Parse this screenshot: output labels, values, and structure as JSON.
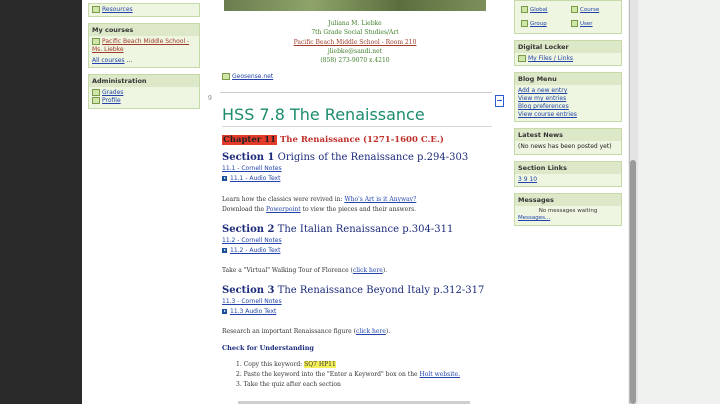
{
  "left": {
    "resources": "Resources",
    "my_courses_title": "My courses",
    "course_link": "Pacific Beach Middle School - Ms. Liebke",
    "all_courses": "All courses",
    "all_courses_suffix": " ...",
    "admin_title": "Administration",
    "admin_items": [
      "Grades",
      "Profile"
    ]
  },
  "contact": {
    "name": "Juliana M. Liebke",
    "role": "7th Grade Social Studies/Art",
    "school": "Pacific Beach Middle School - Room 210",
    "email": "jliebke@sandi.net",
    "phone": "(858) 273-9070 x.4210"
  },
  "geo_link": "Geosense.net",
  "section_number": "9",
  "main": {
    "title": "HSS 7.8 The Renaissance",
    "chapter_tag": "Chapter 11",
    "chapter_title": " The Renaissance (1271-1600 C.E.)",
    "s1_label": "Section 1",
    "s1_title": " Origins of the Renaissance p.294-303",
    "s1_notes": "11.1 - Cornell Notes",
    "s1_audio": "11.1 - Audio Text",
    "s1_text_pre": "Learn how the classics were revived in: ",
    "s1_text_link": "Who's Art is it Anyway?",
    "s1_text2_pre": "Download the ",
    "s1_text2_link": "Powerpoint",
    "s1_text2_post": " to view the pieces and their answers.",
    "s2_label": "Section 2",
    "s2_title": " The Italian Renaissance p.304-311",
    "s2_notes": "11.2 - Cornell Notes",
    "s2_audio": "11.2 - Audio Text",
    "s2_text_pre": "Take a \"Virtual\" Walking Tour of Florence (",
    "s2_text_link": "click here",
    "s2_text_post": ").",
    "s3_label": "Section 3",
    "s3_title": " The Renaissance Beyond Italy p.312-317",
    "s3_notes": "11.3 - Cornell Notes",
    "s3_audio": "11.3 Audio Text",
    "s3_text_pre": "Research an important Renaissance figure (",
    "s3_text_link": "click here",
    "s3_text_post": ").",
    "cfu": "Check for Understanding",
    "step1_pre": "1.   Copy this keyword: ",
    "step1_key": "SQ7 HP11",
    "step2_pre": "2.   Paste the keyword into the \"Enter a Keyword\" box on the ",
    "step2_link": "Holt website.",
    "step3": "3.   Take the quiz after each section"
  },
  "right": {
    "icons": [
      "Global",
      "Course",
      "Group",
      "User"
    ],
    "digital_locker_title": "Digital Locker",
    "my_files": "My Files / Links",
    "blog_menu_title": "Blog Menu",
    "blog_items": [
      "Add a new entry",
      "View my entries",
      "Blog preferences",
      "View course entries"
    ],
    "news_title": "Latest News",
    "news_text": "(No news has been posted yet)",
    "section_links_title": "Section Links",
    "section_links": "3 9 10",
    "messages_title": "Messages",
    "messages_text": "No messages waiting",
    "messages_link": "Messages..."
  },
  "colors": {
    "title": "#1b8c6e",
    "section": "#1b2a7a",
    "chapter": "#c0302a",
    "link": "#2244aa",
    "block_bg": "#eef5e0"
  }
}
